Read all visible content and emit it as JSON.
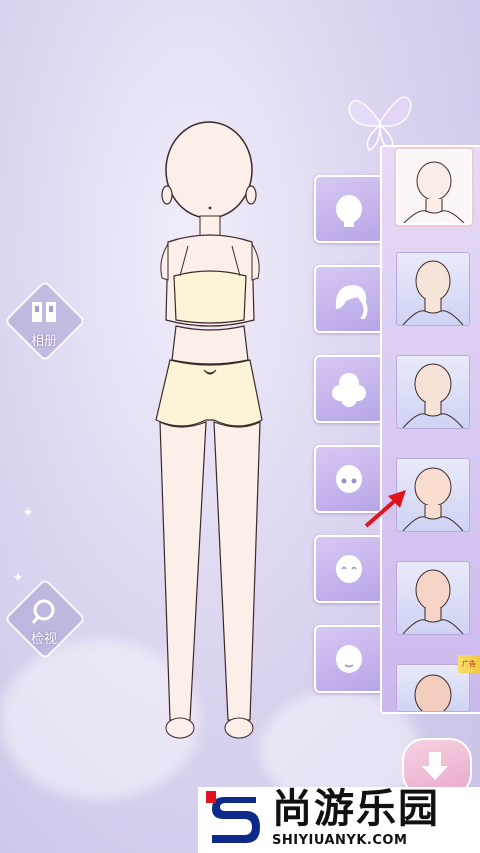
{
  "side_buttons": {
    "album": {
      "label": "相册",
      "glyph": "▯▯"
    },
    "inspect": {
      "label": "检视",
      "glyph": "⌕"
    }
  },
  "category_tabs": [
    {
      "name": "face-shape",
      "icon": "face-outline-icon"
    },
    {
      "name": "hair",
      "icon": "hair-icon"
    },
    {
      "name": "hair-back",
      "icon": "curly-hair-icon"
    },
    {
      "name": "eyes",
      "icon": "face-eyes-icon"
    },
    {
      "name": "expression",
      "icon": "face-smile-icon"
    },
    {
      "name": "mouth",
      "icon": "face-mouth-icon"
    }
  ],
  "options": [
    {
      "id": 1,
      "selected": true,
      "skin": "#fbeee8"
    },
    {
      "id": 2,
      "selected": false,
      "skin": "#f7e4d9"
    },
    {
      "id": 3,
      "selected": false,
      "skin": "#f6e2d6"
    },
    {
      "id": 4,
      "selected": false,
      "skin": "#f8ddd0"
    },
    {
      "id": 5,
      "selected": false,
      "skin": "#f6d5c8"
    },
    {
      "id": 6,
      "selected": false,
      "skin": "#f3cdbd"
    }
  ],
  "ad_tag": {
    "text": "广告"
  },
  "watermark": {
    "title": "尚游乐园",
    "url": "SHIYIUANYK.COM"
  },
  "colors": {
    "accent_purple": "#b6a5e6",
    "panel_bg": "#d6c6f1",
    "arrow_red": "#e0141f",
    "skin": "#fceee9",
    "outfit": "#fbf4d6"
  }
}
